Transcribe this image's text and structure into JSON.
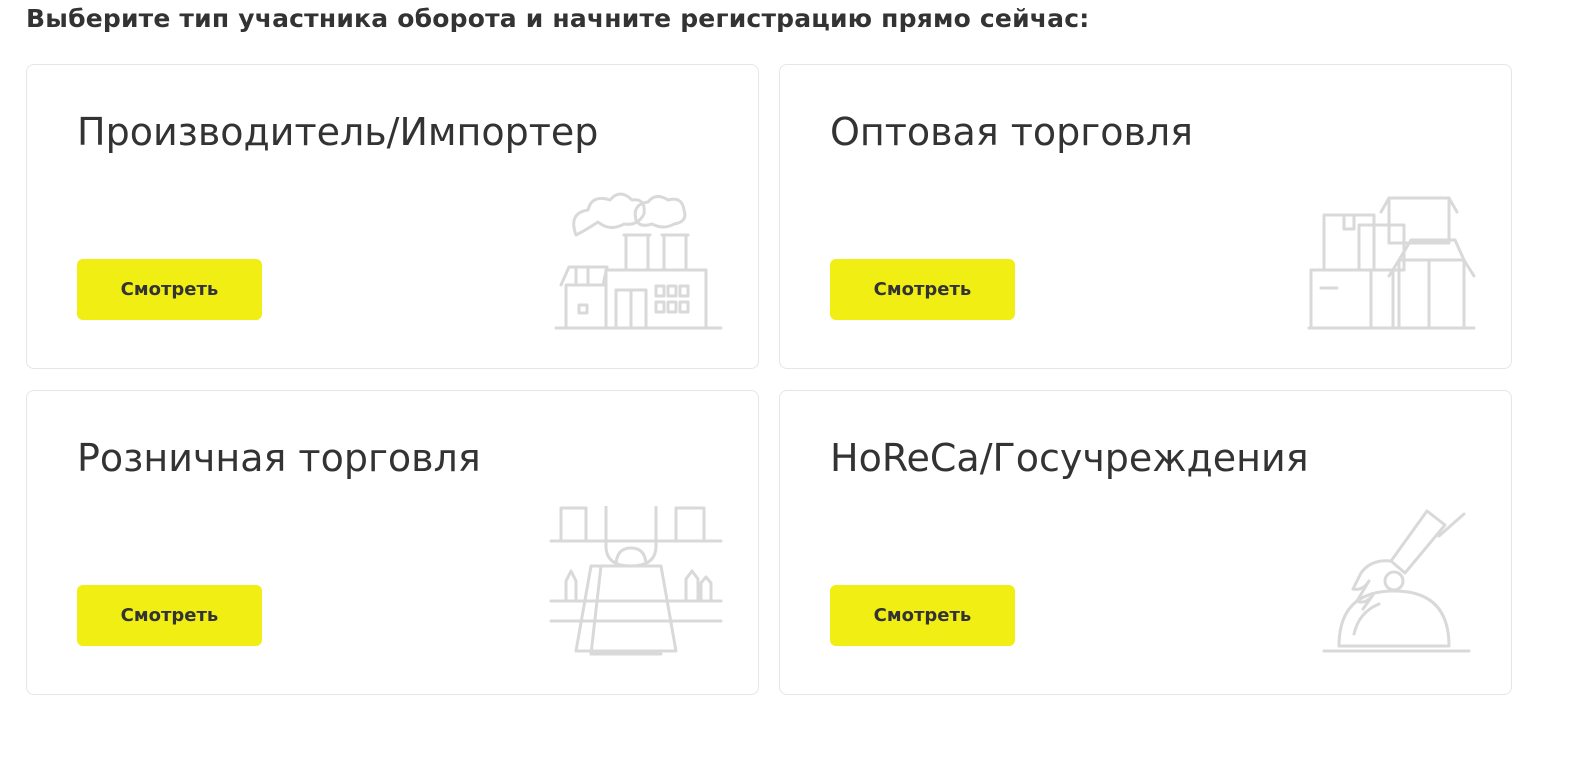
{
  "intro": "Выберите тип участника оборота и начните регистрацию прямо сейчас:",
  "cards": [
    {
      "title": "Производитель/Импортер",
      "button": "Смотреть",
      "icon": "factory-icon"
    },
    {
      "title": "Оптовая торговля",
      "button": "Смотреть",
      "icon": "boxes-icon"
    },
    {
      "title": "Розничная торговля",
      "button": "Смотреть",
      "icon": "shopping-bag-icon"
    },
    {
      "title": "HoReCa/Госучреждения",
      "button": "Смотреть",
      "icon": "cloche-icon"
    }
  ],
  "colors": {
    "button_bg": "#f0ee12",
    "text": "#333333",
    "card_border": "#e6e6e6",
    "illustration": "#d9d9d9"
  }
}
